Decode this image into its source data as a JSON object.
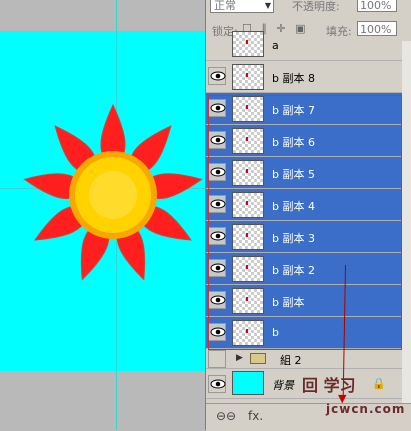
{
  "panel": {
    "blend_mode": "正常",
    "opacity_label": "不透明度:",
    "opacity_value": "100%",
    "lock_label": "锁定:",
    "lock_icons": "☐ ∥ ✛ ▣",
    "fill_label": "填充:",
    "fill_value": "100%"
  },
  "layers": {
    "top_partial": "a",
    "items": [
      {
        "label": "b 副本 8"
      },
      {
        "label": "b 副本 7"
      },
      {
        "label": "b 副本 6"
      },
      {
        "label": "b 副本 5"
      },
      {
        "label": "b 副本 4"
      },
      {
        "label": "b 副本 3"
      },
      {
        "label": "b 副本 2"
      },
      {
        "label": "b 副本"
      },
      {
        "label": "b"
      }
    ],
    "group_label": "組 2",
    "background_label": "背景",
    "lock_mark": "🔒"
  },
  "bottom_bar": {
    "link": "⊖⊖",
    "fx": "fx."
  },
  "watermark": {
    "main": "jcwcn.com",
    "logo": "回 学习"
  },
  "colors": {
    "canvas": "#00ffff",
    "selection": "#3a6ec8",
    "petal": "#ff1f1f",
    "center": "#ffd200"
  }
}
